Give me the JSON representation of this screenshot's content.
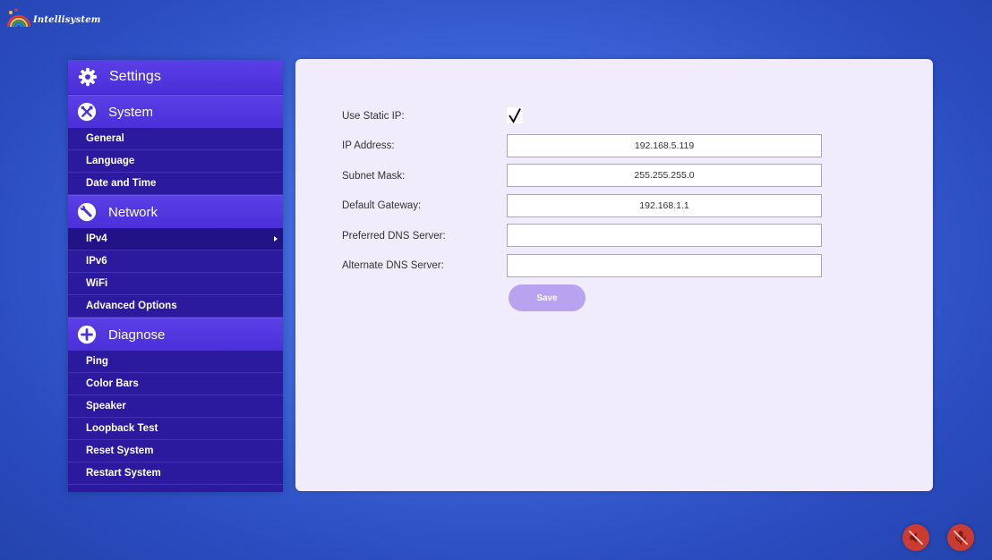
{
  "brand": {
    "name": "Intellisystem"
  },
  "sidebar": {
    "header": {
      "label": "Settings",
      "icon": "gear-icon"
    },
    "sections": [
      {
        "label": "System",
        "icon": "tools-icon",
        "items": [
          {
            "label": "General"
          },
          {
            "label": "Language"
          },
          {
            "label": "Date and Time"
          }
        ]
      },
      {
        "label": "Network",
        "icon": "wrench-icon",
        "items": [
          {
            "label": "IPv4",
            "active": true
          },
          {
            "label": "IPv6"
          },
          {
            "label": "WiFi"
          },
          {
            "label": "Advanced Options"
          }
        ]
      },
      {
        "label": "Diagnose",
        "icon": "plus-circle-icon",
        "items": [
          {
            "label": "Ping"
          },
          {
            "label": "Color Bars"
          },
          {
            "label": "Speaker"
          },
          {
            "label": "Loopback Test"
          },
          {
            "label": "Reset System"
          },
          {
            "label": "Restart System"
          }
        ]
      }
    ]
  },
  "form": {
    "static_ip": {
      "label": "Use Static IP:",
      "checked": true
    },
    "ip_address": {
      "label": "IP Address:",
      "value": "192.168.5.119"
    },
    "subnet_mask": {
      "label": "Subnet Mask:",
      "value": "255.255.255.0"
    },
    "default_gateway": {
      "label": "Default Gateway:",
      "value": "192.168.1.1"
    },
    "preferred_dns": {
      "label": "Preferred DNS Server:",
      "value": ""
    },
    "alternate_dns": {
      "label": "Alternate DNS Server:",
      "value": ""
    },
    "save_label": "Save"
  },
  "footer": {
    "speaker_muted_icon": "speaker-muted-icon",
    "mic_muted_icon": "mic-muted-icon",
    "accent_color": "#ca3b32"
  },
  "colors": {
    "sidebar_bg": "#2c1a9e",
    "sidebar_section": "#4b30d9",
    "panel_bg": "#f0ecfb",
    "save_button": "#b9a3f0"
  }
}
